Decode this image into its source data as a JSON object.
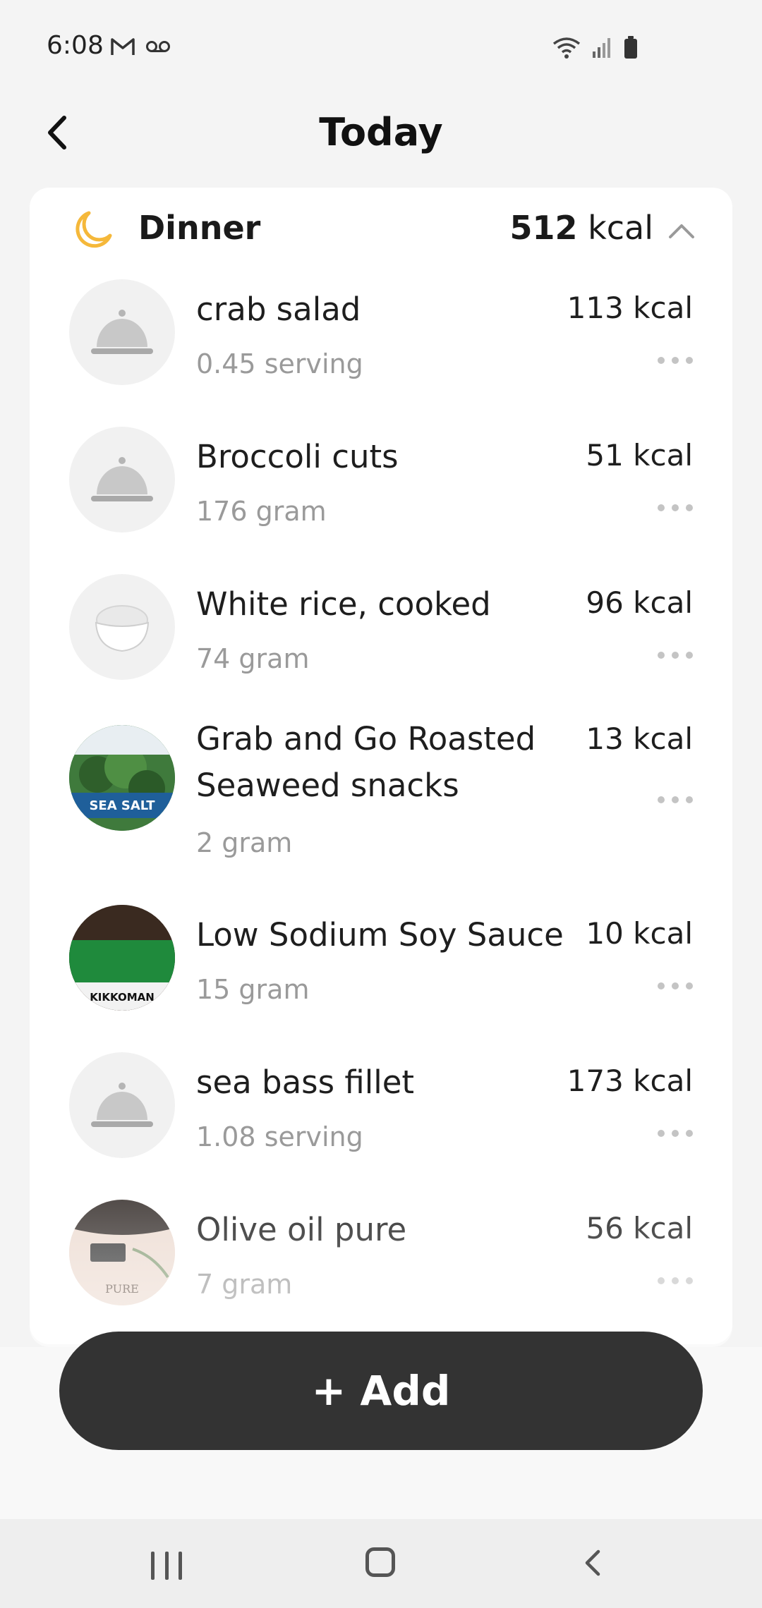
{
  "status_bar": {
    "time": "6:08",
    "left_icons": [
      "gmail-icon",
      "voicemail-icon"
    ],
    "right_icons": [
      "wifi-icon",
      "signal-icon",
      "battery-icon"
    ]
  },
  "header": {
    "title": "Today",
    "back_icon": "chevron-left-icon"
  },
  "meal": {
    "name": "Dinner",
    "icon": "moon-icon",
    "total_kcal_value": "512",
    "total_kcal_unit": "kcal",
    "collapse_icon": "chevron-up-icon",
    "items": [
      {
        "name": "crab salad",
        "amount": "0.45 serving",
        "kcal": "113 kcal",
        "thumb": "cloche-icon"
      },
      {
        "name": "Broccoli cuts",
        "amount": "176 gram",
        "kcal": "51 kcal",
        "thumb": "cloche-icon"
      },
      {
        "name": "White rice, cooked",
        "amount": "74 gram",
        "kcal": "96 kcal",
        "thumb": "rice-bowl-image"
      },
      {
        "name": "Grab and Go Roasted Seaweed snacks",
        "amount": "2 gram",
        "kcal": "13 kcal",
        "thumb": "seaweed-package-image",
        "thumb_text": "SEA SALT"
      },
      {
        "name": "Low Sodium Soy Sauce",
        "amount": "15 gram",
        "kcal": "10 kcal",
        "thumb": "soy-sauce-bottle-image",
        "thumb_text": "KIKKOMAN"
      },
      {
        "name": "sea bass fillet",
        "amount": "1.08 serving",
        "kcal": "173 kcal",
        "thumb": "cloche-icon"
      },
      {
        "name": "Olive oil pure",
        "amount": "7 gram",
        "kcal": "56 kcal",
        "thumb": "olive-oil-bottle-image",
        "thumb_text": "PURE"
      }
    ]
  },
  "add_button": {
    "label": "+ Add"
  },
  "colors": {
    "background": "#f4f4f4",
    "card": "#ffffff",
    "accent_moon": "#f5b83a",
    "button": "#333333",
    "muted_text": "#9a9a9a"
  }
}
